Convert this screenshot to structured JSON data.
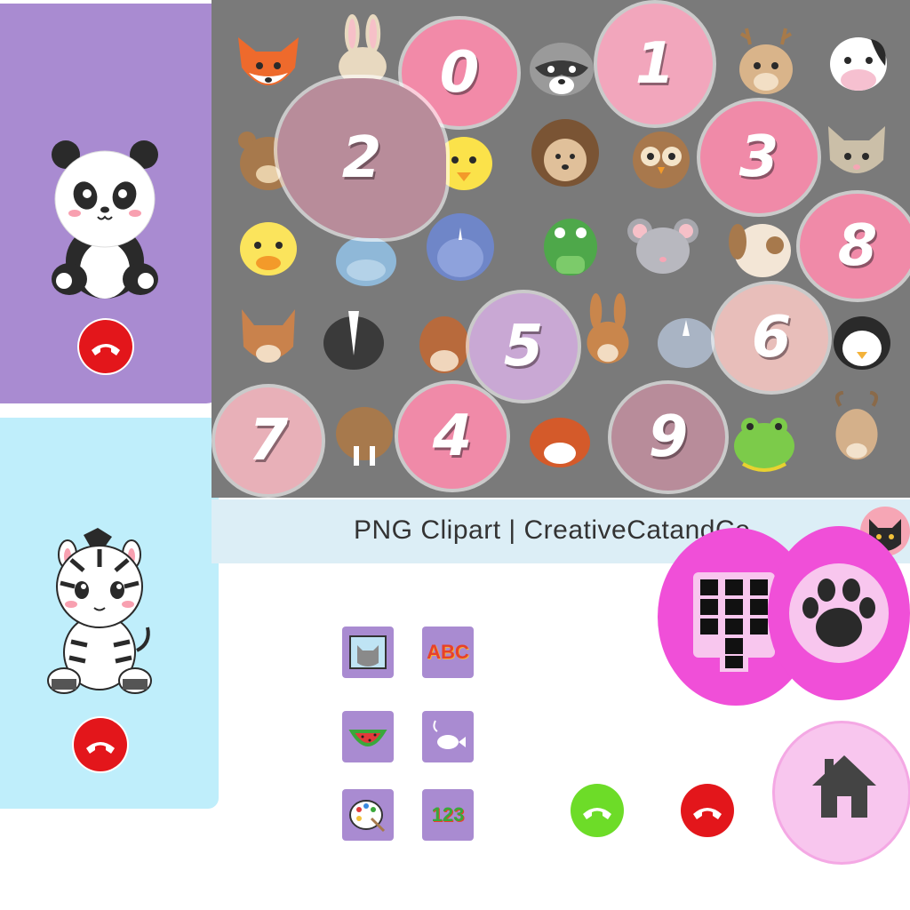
{
  "board": {
    "numbers": [
      "0",
      "1",
      "2",
      "3",
      "8",
      "5",
      "6",
      "7",
      "4",
      "9"
    ]
  },
  "banner": {
    "text": "PNG Clipart  |  CreativeCatandCo"
  },
  "icons": {
    "keypad": "keypad-icon",
    "paw": "paw-icon",
    "home": "home-icon",
    "hangup": "phone-hangup-icon",
    "answer": "phone-answer-icon"
  },
  "tiles": {
    "abc": "ABC",
    "numbers": "123"
  },
  "colors": {
    "purple_card": "#a98bd1",
    "blue_card": "#bfeefb",
    "magenta": "#f04fd8",
    "light_pink": "#f8c6ee",
    "red": "#e3161b",
    "green": "#6ddc28",
    "board_gray": "#7a7a7a"
  }
}
